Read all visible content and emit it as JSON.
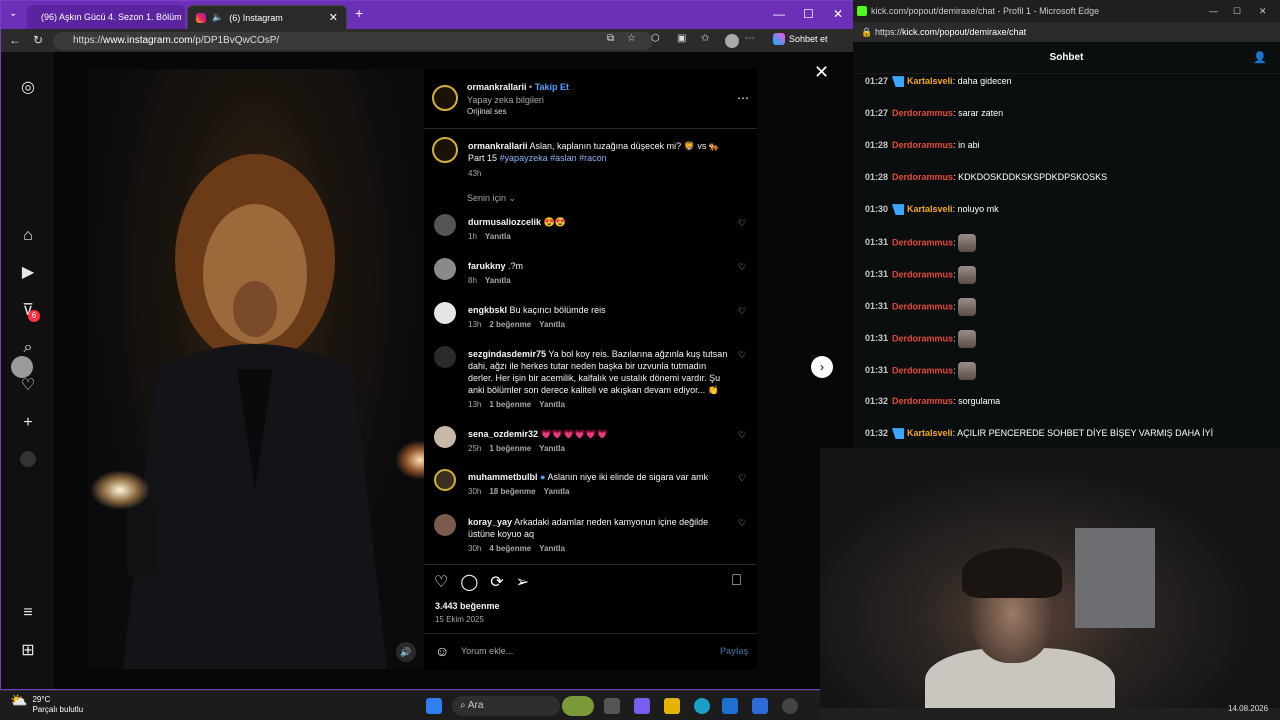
{
  "left_window": {
    "tabs": [
      {
        "label": "(96) Aşkın Gücü 4. Sezon 1. Bölüm",
        "icon": "youtube-icon"
      },
      {
        "label": "(6) Instagram",
        "icon": "instagram-icon"
      }
    ],
    "url_prefix": "https://",
    "url_host": "www.instagram.com",
    "url_path": "/p/DP1BvQwCOsP/",
    "sohbet_btn": "Sohbet et"
  },
  "instagram": {
    "notification_count": "6",
    "post": {
      "author": "ormankrallarii",
      "follow_label": "Takip Et",
      "ai_info": "Yapay zeka bilgileri",
      "audio": "Orijinal ses",
      "caption_user": "ormankrallarii",
      "caption_text": "Aslan, kaplanın tuzağına düşecek mi? 🦁 vs 🐅",
      "caption_part": "Part 15",
      "caption_tags": "#yapayzeka #aslan #racon",
      "caption_time": "43h",
      "sort_label": "Senin için",
      "likes": "3.443 beğenme",
      "date": "15 Ekim 2025",
      "comment_placeholder": "Yorum ekle...",
      "share_label": "Paylaş"
    },
    "comments": [
      {
        "user": "durmusaliozcelik",
        "text": "😍😍",
        "time": "1h",
        "likes": "",
        "reply": "Yanıtla"
      },
      {
        "user": "farukkny",
        "text": ".?m",
        "time": "8h",
        "likes": "",
        "reply": "Yanıtla"
      },
      {
        "user": "engkbskl",
        "text": "Bu kaçıncı bölümde reis",
        "time": "13h",
        "likes": "2 beğenme",
        "reply": "Yanıtla"
      },
      {
        "user": "sezgindasdemir75",
        "text": "Ya bol koy reis. Bazılarına ağzınla kuş tutsan dahi, ağzı ile herkes tutar neden başka bir uzvunla tutmadın derler. Her işin bir acemilik, kalfalık ve ustalık dönemi vardır. Şu anki bölümler son derece kaliteli ve akışkan devam ediyor... 👏",
        "time": "13h",
        "likes": "1 beğenme",
        "reply": "Yanıtla"
      },
      {
        "user": "sena_ozdemir32",
        "text": "💗💗💗💗💗💗",
        "time": "25h",
        "likes": "1 beğenme",
        "reply": "Yanıtla"
      },
      {
        "user": "muhammetbulbl",
        "text": "Aslanın niye iki elinde de sigara var amk",
        "time": "30h",
        "likes": "18 beğenme",
        "reply": "Yanıtla"
      },
      {
        "user": "koray_yay",
        "text": "Arkadaki adamlar neden kamyonun içine değilde üstüne koyuo aq",
        "time": "30h",
        "likes": "4 beğenme",
        "reply": "Yanıtla"
      }
    ]
  },
  "right_window": {
    "title": "kick.com/popout/demiraxe/chat - Profil 1 - Microsoft Edge",
    "url_prefix": "https://",
    "url_rest": "kick.com/popout/demiraxe/chat",
    "header": "Sohbet",
    "messages": [
      {
        "time": "01:27",
        "user": "Kartalsveli",
        "badge": true,
        "text": "daha gidecen"
      },
      {
        "time": "01:27",
        "user": "Derdorammus",
        "badge": false,
        "text": "sarar zaten"
      },
      {
        "time": "01:28",
        "user": "Derdorammus",
        "badge": false,
        "text": "in abi"
      },
      {
        "time": "01:28",
        "user": "Derdorammus",
        "badge": false,
        "text": "KDKDOSKDDKSKSPDKDPSKOSKS"
      },
      {
        "time": "01:30",
        "user": "Kartalsveli",
        "badge": true,
        "text": "noluyo mk"
      },
      {
        "time": "01:31",
        "user": "Derdorammus",
        "badge": false,
        "text": ""
      },
      {
        "time": "01:31",
        "user": "Derdorammus",
        "badge": false,
        "text": ""
      },
      {
        "time": "01:31",
        "user": "Derdorammus",
        "badge": false,
        "text": ""
      },
      {
        "time": "01:31",
        "user": "Derdorammus",
        "badge": false,
        "text": ""
      },
      {
        "time": "01:31",
        "user": "Derdorammus",
        "badge": false,
        "text": ""
      },
      {
        "time": "01:32",
        "user": "Derdorammus",
        "badge": false,
        "text": "sorgulama"
      },
      {
        "time": "01:32",
        "user": "Kartalsveli",
        "badge": true,
        "text": "AÇILIR PENCEREDE SOHBET DİYE BİŞEY VARMIŞ DAHA İYİ"
      }
    ]
  },
  "taskbar": {
    "temp": "29°C",
    "weather": "Parçalı bulutlu",
    "search": "Ara",
    "date": "14.08.2026"
  }
}
